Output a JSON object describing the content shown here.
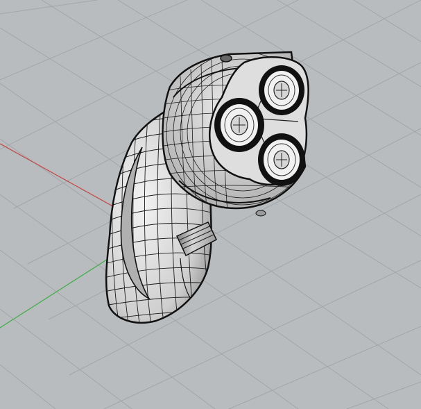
{
  "viewport": {
    "background": "#b9bcbf",
    "grid_color": "#a6a9ac",
    "x_axis_color": "#c0504d",
    "y_axis_color": "#3fae49"
  },
  "model": {
    "object": "electric-shaver",
    "shading": "wireframe-over-shaded",
    "body_color": "#d9d9d9",
    "wire_color": "#111111",
    "cutter_heads": 3
  }
}
